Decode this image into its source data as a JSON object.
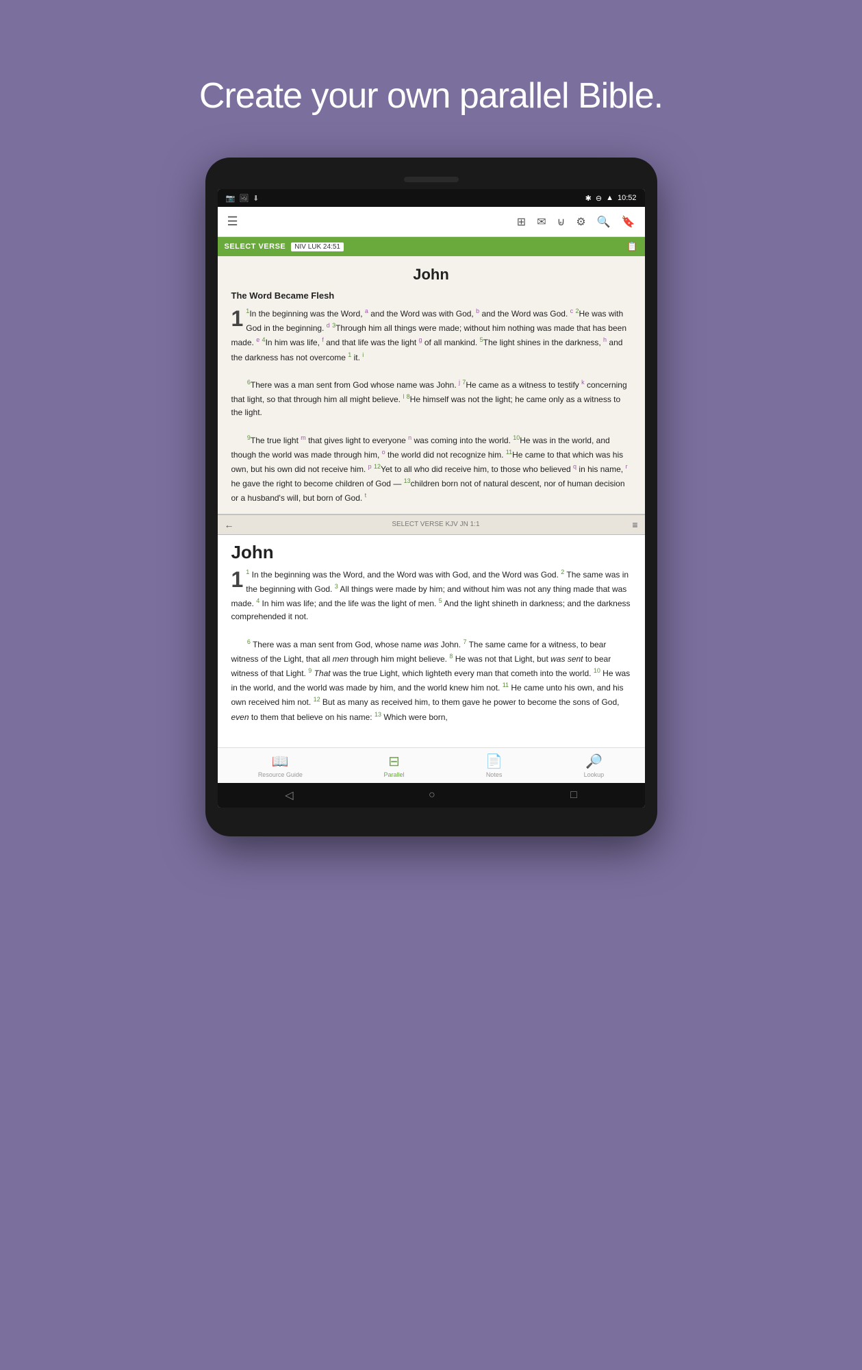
{
  "headline": "Create your own parallel Bible.",
  "status_bar": {
    "time": "10:52",
    "icons": [
      "notification1",
      "notification2",
      "notification3",
      "notification4"
    ]
  },
  "toolbar": {
    "icons": [
      "library",
      "message",
      "cart",
      "settings",
      "search",
      "bookmark"
    ]
  },
  "select_verse_bar": {
    "label": "SELECT VERSE",
    "ref": "NIV LUK 24:51"
  },
  "top_panel": {
    "book_title": "John",
    "section_heading": "The Word Became Flesh",
    "text": "1 In the beginning was the Word, and the Word was with God, and the Word was God. 2 He was with God in the beginning. 3 Through him all things were made; without him nothing was made that has been made. 4 In him was life, and that life was the light of all mankind. 5 The light shines in the darkness, and the darkness has not overcome it. 6 There was a man sent from God whose name was John. 7 He came as a witness to testify concerning that light, so that through him all might believe. 8 He himself was not the light; he came only as a witness to the light. 9 The true light that gives light to everyone was coming into the world. 10 He was in the world, and though the world was made through him, the world did not recognize him. 11 He came to that which was his own, but his own did not receive him. 12 Yet to all who did receive him, to those who believed in his name, he gave the right to become children of God — 13 children born not of natural descent, nor of human decision or a husband's will, but born of God."
  },
  "panel_divider": {
    "text": "SELECT VERSE  KJV JN 1:1"
  },
  "bottom_panel": {
    "book_title": "John",
    "text": "1 In the beginning was the Word, and the Word was with God, and the Word was God. 2 The same was in the beginning with God. 3 All things were made by him; and without him was not any thing made that was made. 4 In him was life; and the life was the light of men. 5 And the light shineth in darkness; and the darkness comprehended it not. 6 There was a man sent from God, whose name was John. 7 The same came for a witness, to bear witness of the Light, that all men through him might believe. 8 He was not that Light, but was sent to bear witness of that Light. 9 That was the true Light, which lighteth every man that cometh into the world. 10 He was in the world, and the world was made by him, and the world knew him not. 11 He came unto his own, and his own received him not. 12 But as many as received him, to them gave he power to become the sons of God, even to them that believe on his name: 13 Which were born,"
  },
  "bottom_nav": {
    "items": [
      {
        "label": "Resource Guide",
        "icon": "book-icon",
        "active": false
      },
      {
        "label": "Parallel",
        "icon": "parallel-icon",
        "active": true
      },
      {
        "label": "Notes",
        "icon": "notes-icon",
        "active": false
      },
      {
        "label": "Lookup",
        "icon": "lookup-icon",
        "active": false
      }
    ]
  },
  "android_nav": {
    "back": "◁",
    "home": "○",
    "recent": "□"
  }
}
